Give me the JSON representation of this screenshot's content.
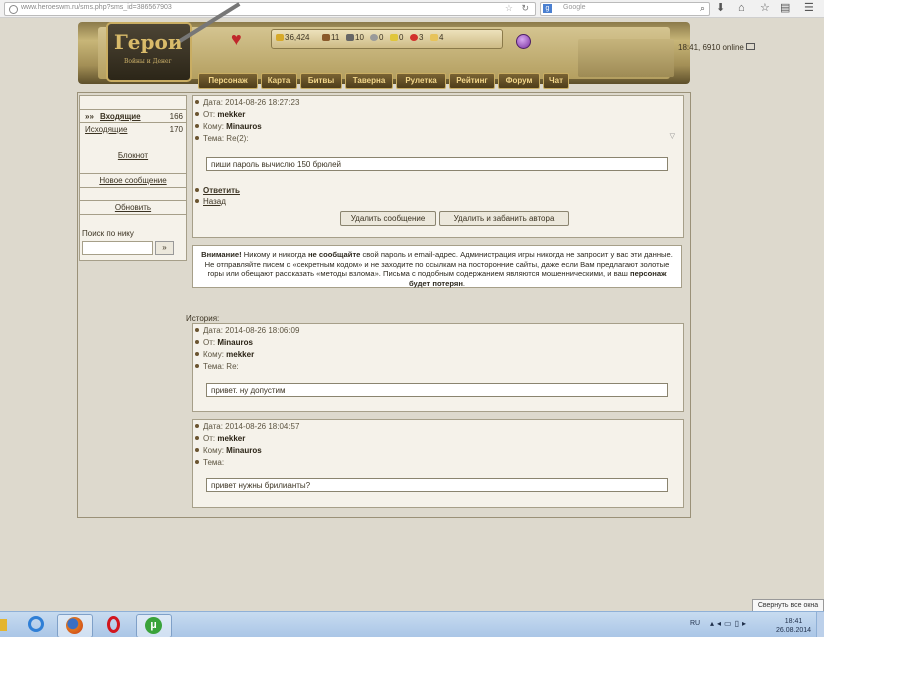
{
  "browser": {
    "url": "www.heroeswm.ru/sms.php?sms_id=386567903",
    "search_placeholder": "Google"
  },
  "game": {
    "logo_title": "Герои",
    "logo_subtitle": "Войны и Денег",
    "status": "18:41, 6910 online",
    "resources": [
      "36,424",
      "11",
      "10",
      "0",
      "0",
      "3",
      "4"
    ]
  },
  "nav": [
    {
      "label": "Персонаж"
    },
    {
      "label": "Карта"
    },
    {
      "label": "Битвы"
    },
    {
      "label": "Таверна"
    },
    {
      "label": "Рулетка"
    },
    {
      "label": "Рейтинг"
    },
    {
      "label": "Форум"
    },
    {
      "label": "Чат"
    }
  ],
  "sidebar": {
    "inbox_prefix": "»»",
    "inbox_label": "Входящие",
    "inbox_count": "166",
    "outbox_label": "Исходящие",
    "outbox_count": "170",
    "notepad_label": "Блокнот",
    "new_message_label": "Новое сообщение",
    "refresh_label": "Обновить",
    "search_label": "Поиск по нику",
    "search_button": "»"
  },
  "current_message": {
    "date_label": "Дата:",
    "date": "2014-08-26 18:27:23",
    "from_label": "От:",
    "from": "mekker",
    "to_label": "Кому:",
    "to": "Minauros",
    "subject_label": "Тема:",
    "subject": "Re(2):",
    "body": "пиши пароль вычислю 150 брюлей",
    "reply_label": "Ответить",
    "back_label": "Назад",
    "delete_button": "Удалить сообщение",
    "delete_ban_button": "Удалить и забанить автора"
  },
  "warning": {
    "p1": "Внимание!",
    "p2": " Никому и никогда ",
    "p3": "не сообщайте",
    "p4": " свой пароль и email-адрес. Администрация игры никогда не запросит у вас эти данные. Не отправляйте писем с «секретным кодом» и не заходите по ссылкам на посторонние сайты, даже если Вам предлагают золотые горы или обещают рассказать «методы взлома». Письма с подобным содержанием являются мошенническими, и ваш ",
    "p5": "персонаж будет потерян",
    "p6": "."
  },
  "history": {
    "label": "История:",
    "messages": [
      {
        "date_label": "Дата:",
        "date": "2014-08-26 18:06:09",
        "from_label": "От:",
        "from": "Minauros",
        "to_label": "Кому:",
        "to": "mekker",
        "subject_label": "Тема:",
        "subject": "Re:",
        "body": "привет. ну допустим"
      },
      {
        "date_label": "Дата:",
        "date": "2014-08-26 18:04:57",
        "from_label": "От:",
        "from": "mekker",
        "to_label": "Кому:",
        "to": "Minauros",
        "subject_label": "Тема:",
        "subject": "",
        "body": "привет нужны брилианты?"
      }
    ]
  },
  "taskbar": {
    "minimize_all": "Свернуть все окна",
    "lang": "RU",
    "time": "18:41",
    "date": "26.08.2014"
  }
}
